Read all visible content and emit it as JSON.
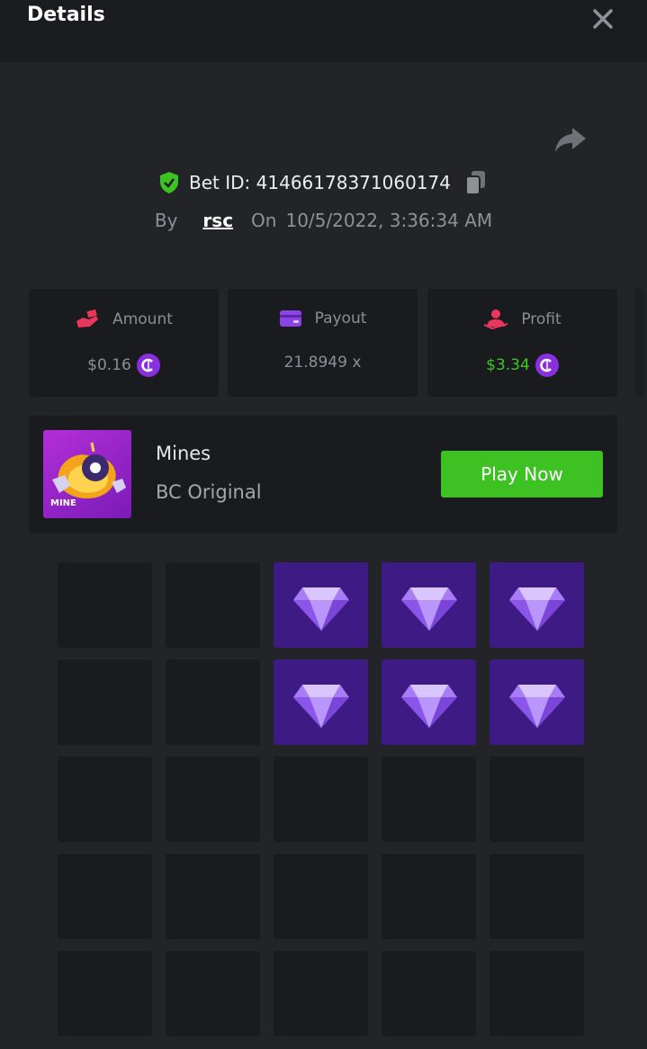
{
  "header": {
    "title": "Details",
    "close_icon": "close-icon"
  },
  "share_icon": "share-icon",
  "bet": {
    "id_label": "Bet ID: 414661783710601​74",
    "by_label": "By",
    "user": "rsc",
    "on_label": "On",
    "date": "10/5/2022, 3:36:34 AM"
  },
  "stats": [
    {
      "label": "Amount",
      "value": "$0.16",
      "icon": "money-hand-icon",
      "has_coin": true
    },
    {
      "label": "Payout",
      "value": "21.8949 x",
      "icon": "wallet-card-icon",
      "has_coin": false
    },
    {
      "label": "Profit",
      "value": "$3.34",
      "icon": "profit-user-icon",
      "has_coin": true
    }
  ],
  "game": {
    "name": "Mines",
    "subtitle": "BC Original",
    "thumb_label": "MINE",
    "play_label": "Play Now"
  },
  "grid": {
    "rows": 5,
    "cols": 5,
    "revealed_gems": [
      [
        0,
        2
      ],
      [
        0,
        3
      ],
      [
        0,
        4
      ],
      [
        1,
        2
      ],
      [
        1,
        3
      ],
      [
        1,
        4
      ]
    ]
  },
  "colors": {
    "background": "#232427",
    "card": "#1a1b1e",
    "accent_green": "#3dc123",
    "gem_tile": "#3e1a85",
    "coin": "#8a2fe0"
  }
}
